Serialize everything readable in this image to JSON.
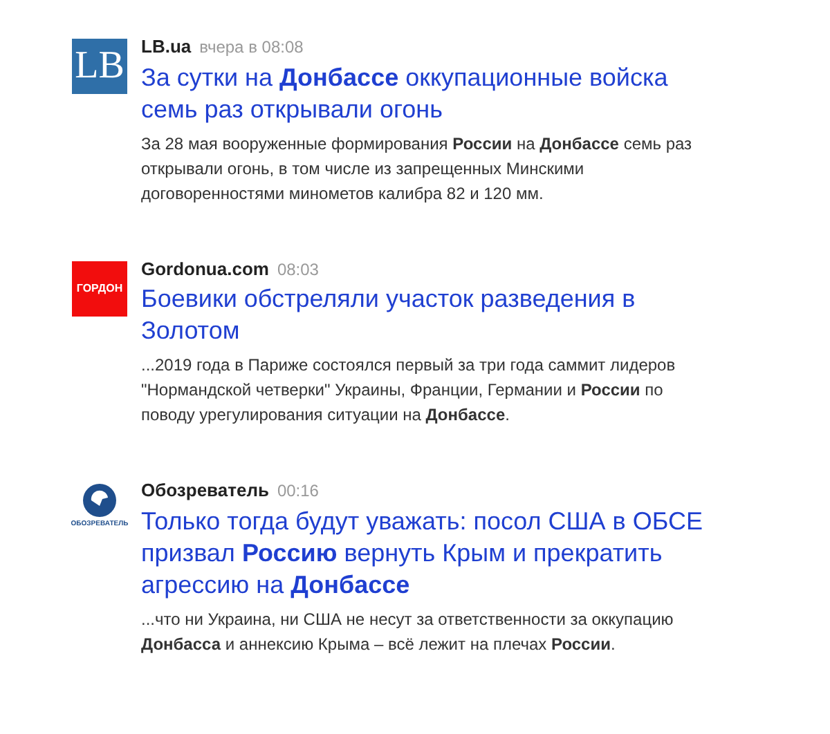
{
  "news": [
    {
      "logo": {
        "kind": "lb",
        "text": "LB"
      },
      "source": "LB.ua",
      "time": "вчера в 08:08",
      "title": "За сутки на **Донбассе** оккупационные войска семь раз открывали огонь",
      "snippet": "За 28 мая вооруженные формирования **России** на **Донбассе** семь раз открывали огонь, в том числе из запрещенных Минскими договоренностями минометов калибра 82 и 120 мм."
    },
    {
      "logo": {
        "kind": "gordon",
        "text": "ГОРДОН"
      },
      "source": "Gordonua.com",
      "time": "08:03",
      "title": "Боевики обстреляли участок разведения в Золотом",
      "snippet": "...2019 года в Париже состоялся первый за три года саммит лидеров \"Нормандской четверки\" Украины, Франции, Германии и **России** по поводу урегулирования ситуации на **Донбассе**."
    },
    {
      "logo": {
        "kind": "obozrevatel",
        "text": "ОБОЗРЕВАТЕЛЬ"
      },
      "source": "Обозреватель",
      "time": "00:16",
      "title": "Только тогда будут уважать: посол США в ОБСЕ призвал **Россию** вернуть Крым и прекратить агрессию на **Донбассе**",
      "snippet": "...что ни Украина, ни США не несут за ответственности за оккупацию **Донбасса** и аннексию Крыма – всё лежит на плечах **России**."
    }
  ]
}
